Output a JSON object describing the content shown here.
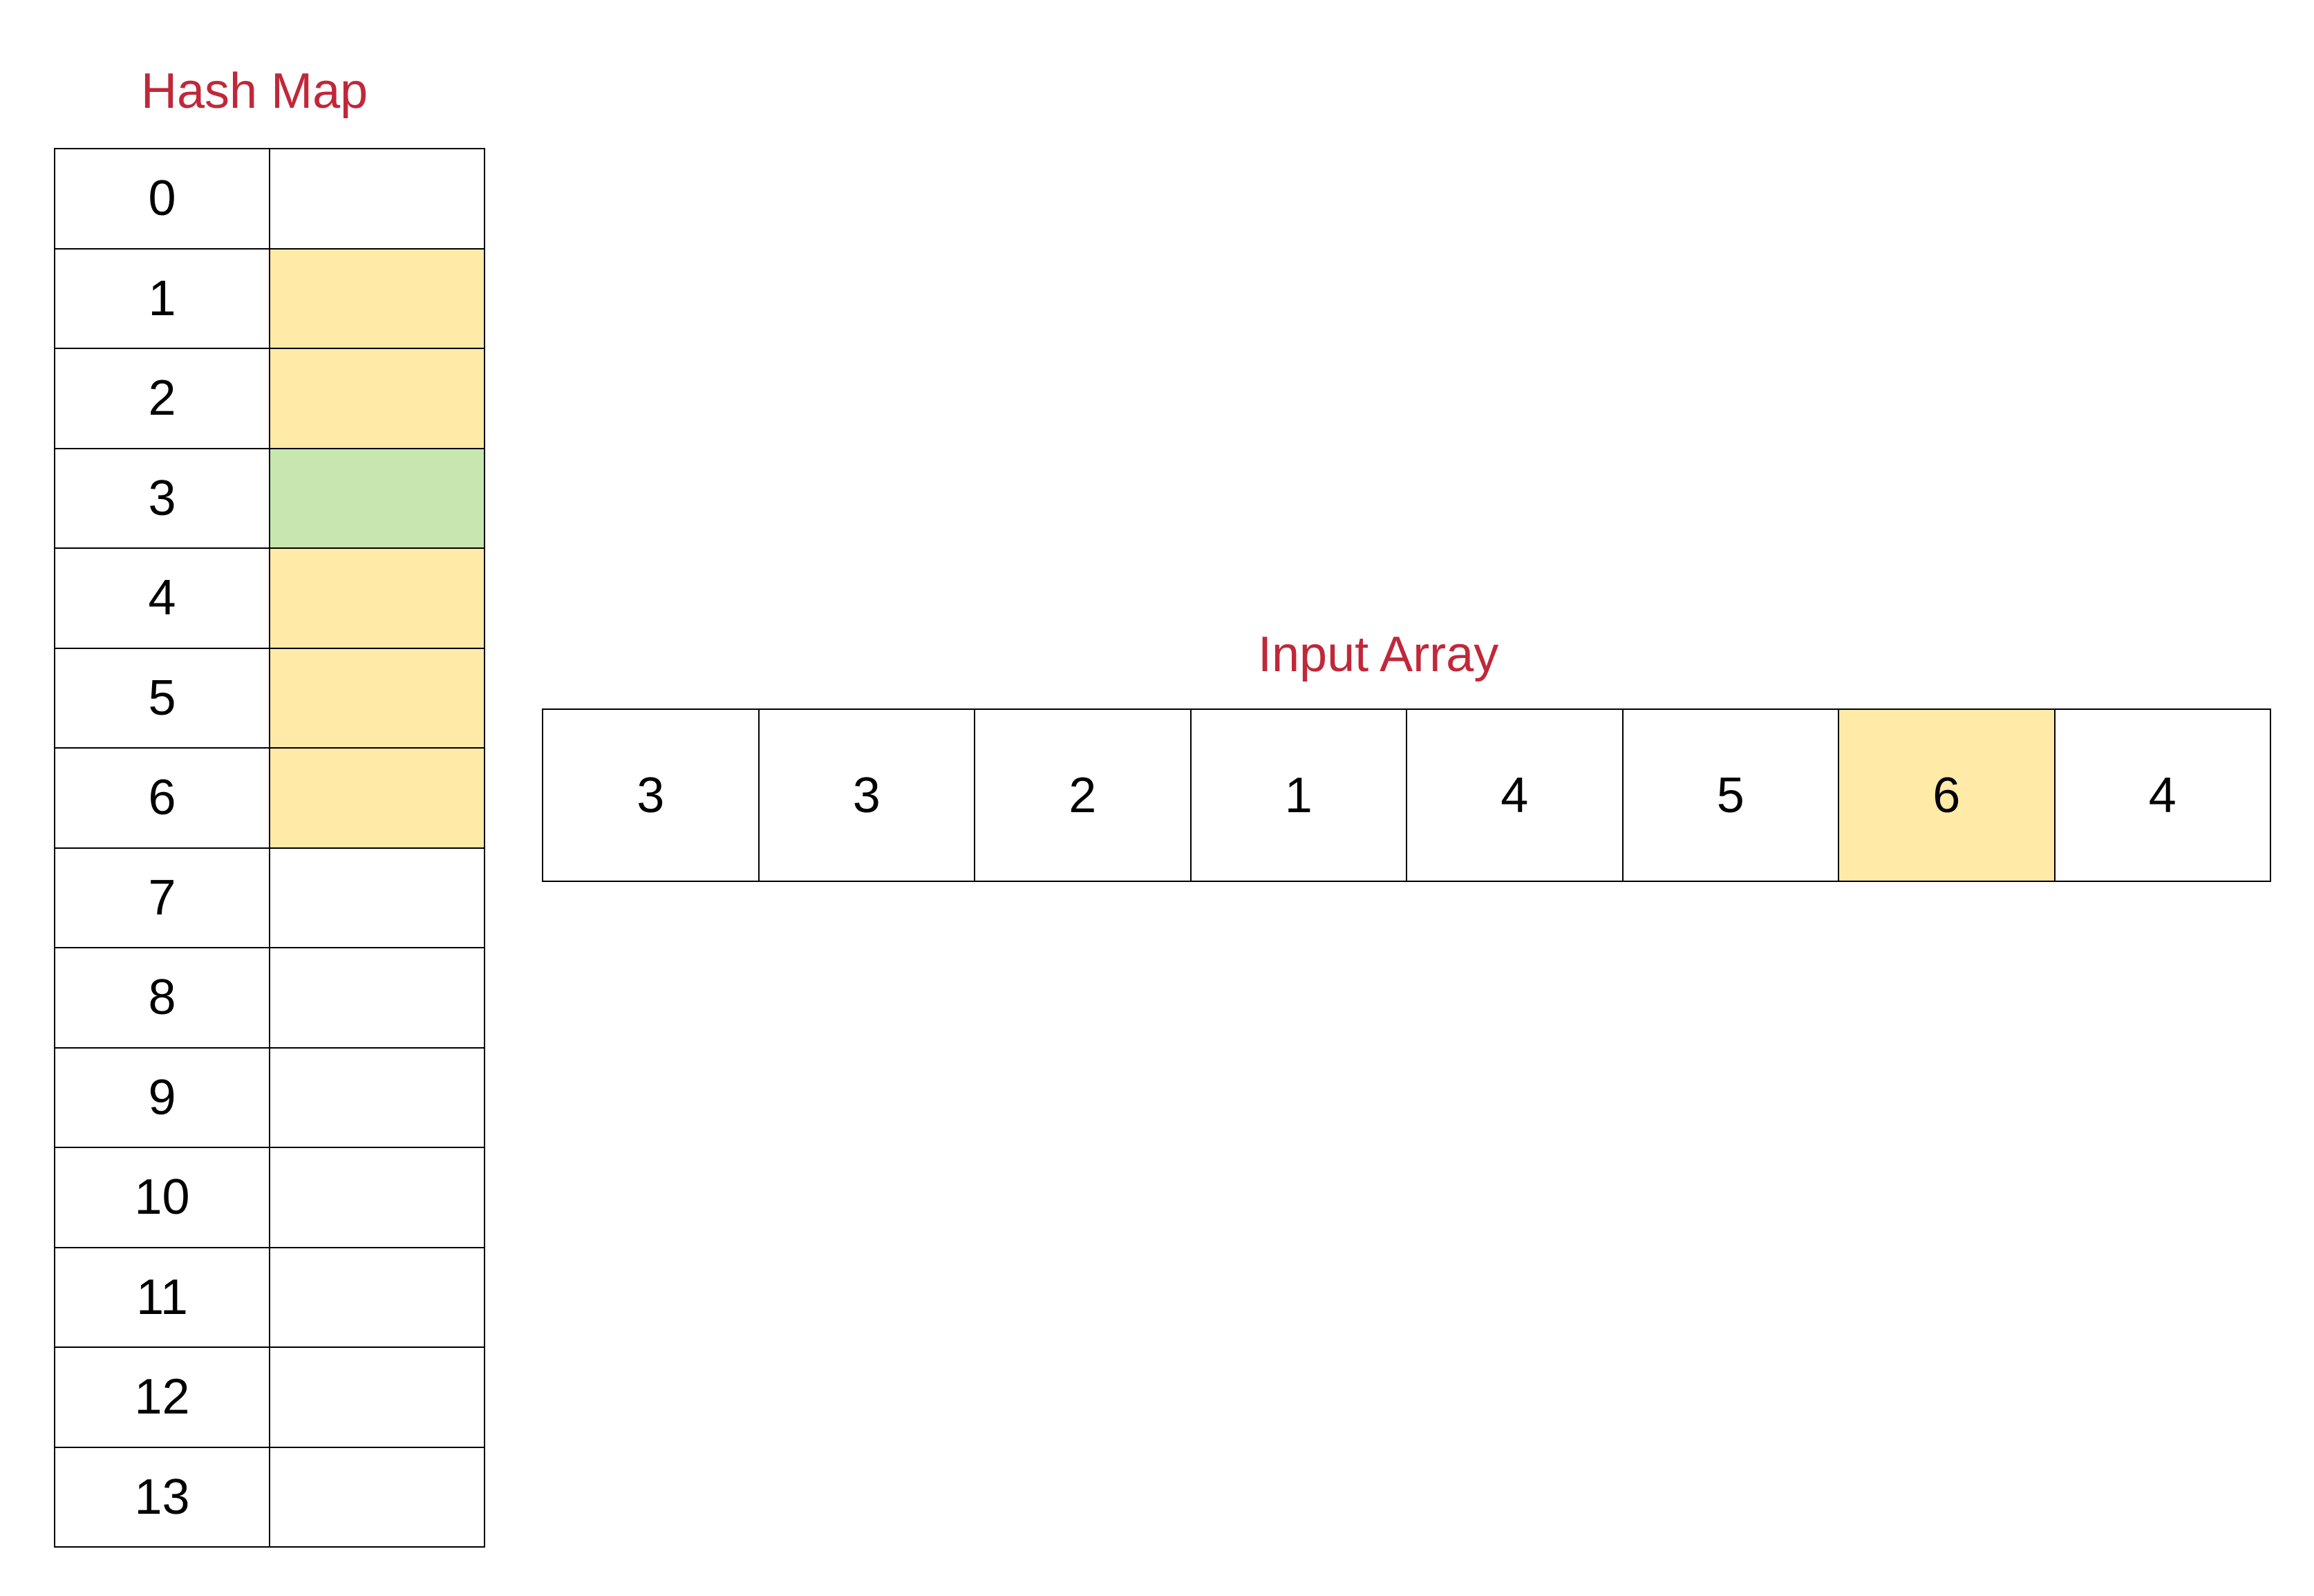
{
  "colors": {
    "title": "#c0283a",
    "visited": "#ffeaa8",
    "current": "#c8e6b0",
    "empty": "#ffffff",
    "border": "#000000"
  },
  "hash_map": {
    "title": "Hash Map",
    "rows": [
      {
        "index": "0",
        "state": "empty"
      },
      {
        "index": "1",
        "state": "visited"
      },
      {
        "index": "2",
        "state": "visited"
      },
      {
        "index": "3",
        "state": "current"
      },
      {
        "index": "4",
        "state": "visited"
      },
      {
        "index": "5",
        "state": "visited"
      },
      {
        "index": "6",
        "state": "visited"
      },
      {
        "index": "7",
        "state": "empty"
      },
      {
        "index": "8",
        "state": "empty"
      },
      {
        "index": "9",
        "state": "empty"
      },
      {
        "index": "10",
        "state": "empty"
      },
      {
        "index": "11",
        "state": "empty"
      },
      {
        "index": "12",
        "state": "empty"
      },
      {
        "index": "13",
        "state": "empty"
      }
    ]
  },
  "input_array": {
    "title": "Input Array",
    "cells": [
      {
        "value": "3",
        "state": "empty"
      },
      {
        "value": "3",
        "state": "empty"
      },
      {
        "value": "2",
        "state": "empty"
      },
      {
        "value": "1",
        "state": "empty"
      },
      {
        "value": "4",
        "state": "empty"
      },
      {
        "value": "5",
        "state": "empty"
      },
      {
        "value": "6",
        "state": "visited"
      },
      {
        "value": "4",
        "state": "empty"
      }
    ]
  }
}
